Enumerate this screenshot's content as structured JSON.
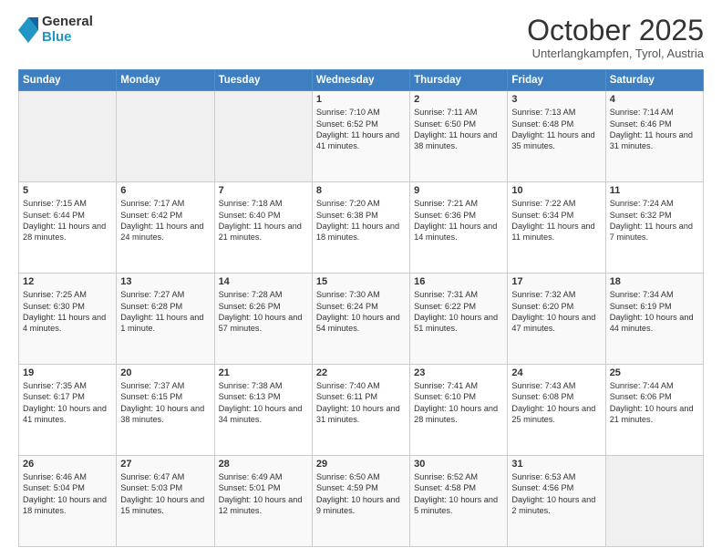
{
  "logo": {
    "general": "General",
    "blue": "Blue"
  },
  "header": {
    "month": "October 2025",
    "location": "Unterlangkampfen, Tyrol, Austria"
  },
  "days": [
    "Sunday",
    "Monday",
    "Tuesday",
    "Wednesday",
    "Thursday",
    "Friday",
    "Saturday"
  ],
  "weeks": [
    [
      {
        "day": "",
        "content": ""
      },
      {
        "day": "",
        "content": ""
      },
      {
        "day": "",
        "content": ""
      },
      {
        "day": "1",
        "content": "Sunrise: 7:10 AM\nSunset: 6:52 PM\nDaylight: 11 hours and 41 minutes."
      },
      {
        "day": "2",
        "content": "Sunrise: 7:11 AM\nSunset: 6:50 PM\nDaylight: 11 hours and 38 minutes."
      },
      {
        "day": "3",
        "content": "Sunrise: 7:13 AM\nSunset: 6:48 PM\nDaylight: 11 hours and 35 minutes."
      },
      {
        "day": "4",
        "content": "Sunrise: 7:14 AM\nSunset: 6:46 PM\nDaylight: 11 hours and 31 minutes."
      }
    ],
    [
      {
        "day": "5",
        "content": "Sunrise: 7:15 AM\nSunset: 6:44 PM\nDaylight: 11 hours and 28 minutes."
      },
      {
        "day": "6",
        "content": "Sunrise: 7:17 AM\nSunset: 6:42 PM\nDaylight: 11 hours and 24 minutes."
      },
      {
        "day": "7",
        "content": "Sunrise: 7:18 AM\nSunset: 6:40 PM\nDaylight: 11 hours and 21 minutes."
      },
      {
        "day": "8",
        "content": "Sunrise: 7:20 AM\nSunset: 6:38 PM\nDaylight: 11 hours and 18 minutes."
      },
      {
        "day": "9",
        "content": "Sunrise: 7:21 AM\nSunset: 6:36 PM\nDaylight: 11 hours and 14 minutes."
      },
      {
        "day": "10",
        "content": "Sunrise: 7:22 AM\nSunset: 6:34 PM\nDaylight: 11 hours and 11 minutes."
      },
      {
        "day": "11",
        "content": "Sunrise: 7:24 AM\nSunset: 6:32 PM\nDaylight: 11 hours and 7 minutes."
      }
    ],
    [
      {
        "day": "12",
        "content": "Sunrise: 7:25 AM\nSunset: 6:30 PM\nDaylight: 11 hours and 4 minutes."
      },
      {
        "day": "13",
        "content": "Sunrise: 7:27 AM\nSunset: 6:28 PM\nDaylight: 11 hours and 1 minute."
      },
      {
        "day": "14",
        "content": "Sunrise: 7:28 AM\nSunset: 6:26 PM\nDaylight: 10 hours and 57 minutes."
      },
      {
        "day": "15",
        "content": "Sunrise: 7:30 AM\nSunset: 6:24 PM\nDaylight: 10 hours and 54 minutes."
      },
      {
        "day": "16",
        "content": "Sunrise: 7:31 AM\nSunset: 6:22 PM\nDaylight: 10 hours and 51 minutes."
      },
      {
        "day": "17",
        "content": "Sunrise: 7:32 AM\nSunset: 6:20 PM\nDaylight: 10 hours and 47 minutes."
      },
      {
        "day": "18",
        "content": "Sunrise: 7:34 AM\nSunset: 6:19 PM\nDaylight: 10 hours and 44 minutes."
      }
    ],
    [
      {
        "day": "19",
        "content": "Sunrise: 7:35 AM\nSunset: 6:17 PM\nDaylight: 10 hours and 41 minutes."
      },
      {
        "day": "20",
        "content": "Sunrise: 7:37 AM\nSunset: 6:15 PM\nDaylight: 10 hours and 38 minutes."
      },
      {
        "day": "21",
        "content": "Sunrise: 7:38 AM\nSunset: 6:13 PM\nDaylight: 10 hours and 34 minutes."
      },
      {
        "day": "22",
        "content": "Sunrise: 7:40 AM\nSunset: 6:11 PM\nDaylight: 10 hours and 31 minutes."
      },
      {
        "day": "23",
        "content": "Sunrise: 7:41 AM\nSunset: 6:10 PM\nDaylight: 10 hours and 28 minutes."
      },
      {
        "day": "24",
        "content": "Sunrise: 7:43 AM\nSunset: 6:08 PM\nDaylight: 10 hours and 25 minutes."
      },
      {
        "day": "25",
        "content": "Sunrise: 7:44 AM\nSunset: 6:06 PM\nDaylight: 10 hours and 21 minutes."
      }
    ],
    [
      {
        "day": "26",
        "content": "Sunrise: 6:46 AM\nSunset: 5:04 PM\nDaylight: 10 hours and 18 minutes."
      },
      {
        "day": "27",
        "content": "Sunrise: 6:47 AM\nSunset: 5:03 PM\nDaylight: 10 hours and 15 minutes."
      },
      {
        "day": "28",
        "content": "Sunrise: 6:49 AM\nSunset: 5:01 PM\nDaylight: 10 hours and 12 minutes."
      },
      {
        "day": "29",
        "content": "Sunrise: 6:50 AM\nSunset: 4:59 PM\nDaylight: 10 hours and 9 minutes."
      },
      {
        "day": "30",
        "content": "Sunrise: 6:52 AM\nSunset: 4:58 PM\nDaylight: 10 hours and 5 minutes."
      },
      {
        "day": "31",
        "content": "Sunrise: 6:53 AM\nSunset: 4:56 PM\nDaylight: 10 hours and 2 minutes."
      },
      {
        "day": "",
        "content": ""
      }
    ]
  ]
}
